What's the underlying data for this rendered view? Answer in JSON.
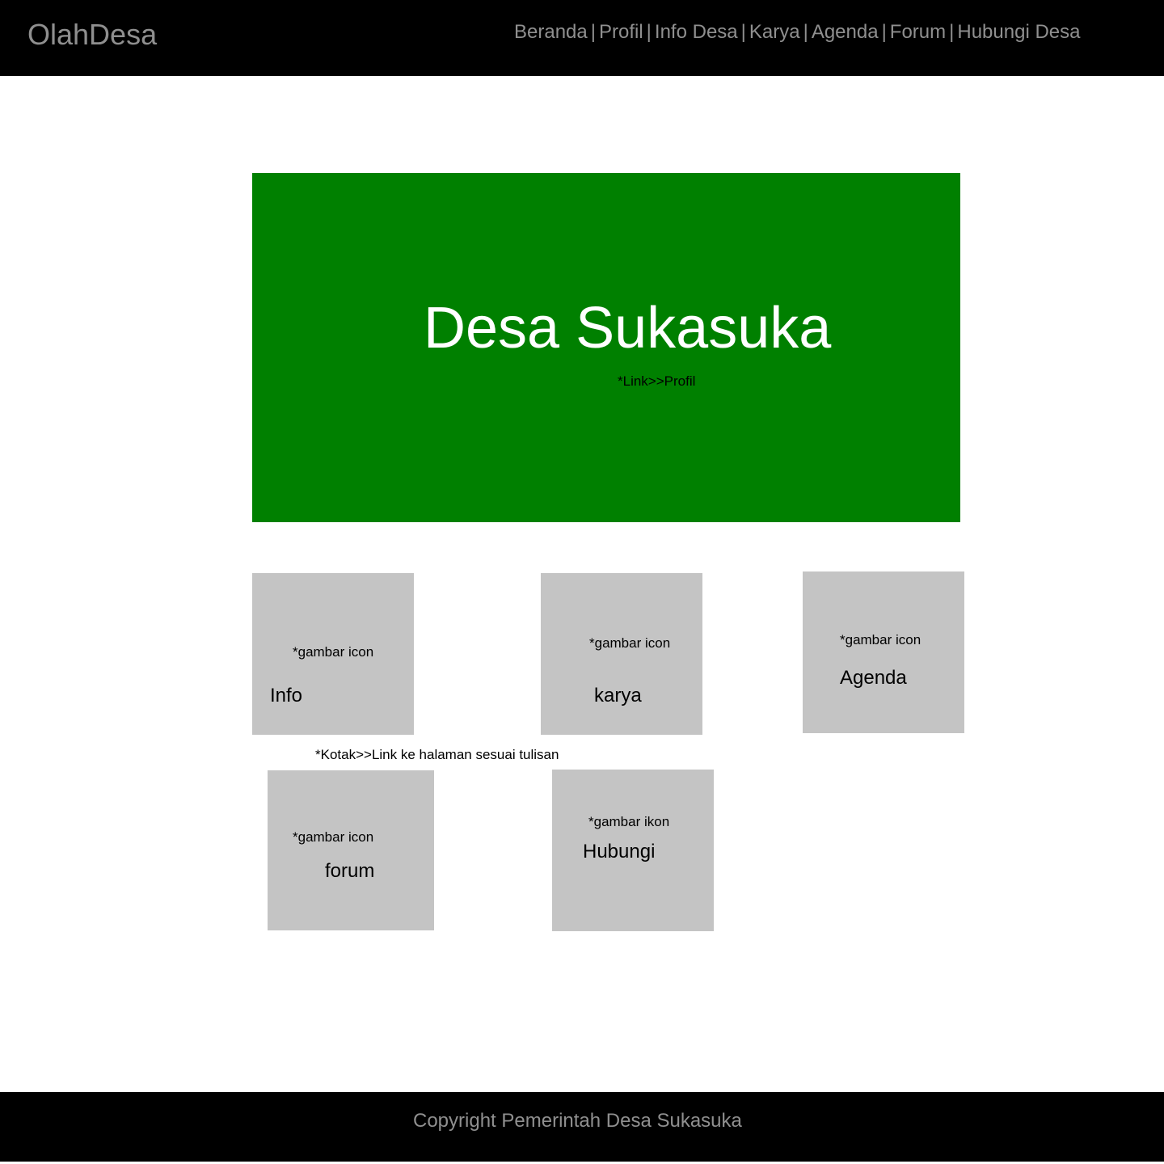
{
  "header": {
    "logo": "OlahDesa",
    "nav": [
      {
        "label": "Beranda"
      },
      {
        "label": "Profil"
      },
      {
        "label": "Info Desa"
      },
      {
        "label": "Karya"
      },
      {
        "label": "Agenda"
      },
      {
        "label": "Forum"
      },
      {
        "label": "Hubungi Desa"
      }
    ],
    "separator": "|"
  },
  "hero": {
    "title": "Desa Sukasuka",
    "note": "*Link>>Profil",
    "background": "#008000"
  },
  "tiles": [
    {
      "note": "*gambar icon",
      "label": "Info"
    },
    {
      "note": "*gambar icon",
      "label": "karya"
    },
    {
      "note": "*gambar icon",
      "label": "Agenda"
    },
    {
      "note": "*gambar icon",
      "label": "forum"
    },
    {
      "note": "*gambar ikon",
      "label": "Hubungi"
    }
  ],
  "boxes_note": "*Kotak>>Link ke halaman sesuai  tulisan",
  "footer": {
    "text": "Copyright Pemerintah Desa Sukasuka"
  },
  "colors": {
    "bar": "#000000",
    "tile": "#c4c4c4",
    "muted_text": "#8f8f8f"
  }
}
